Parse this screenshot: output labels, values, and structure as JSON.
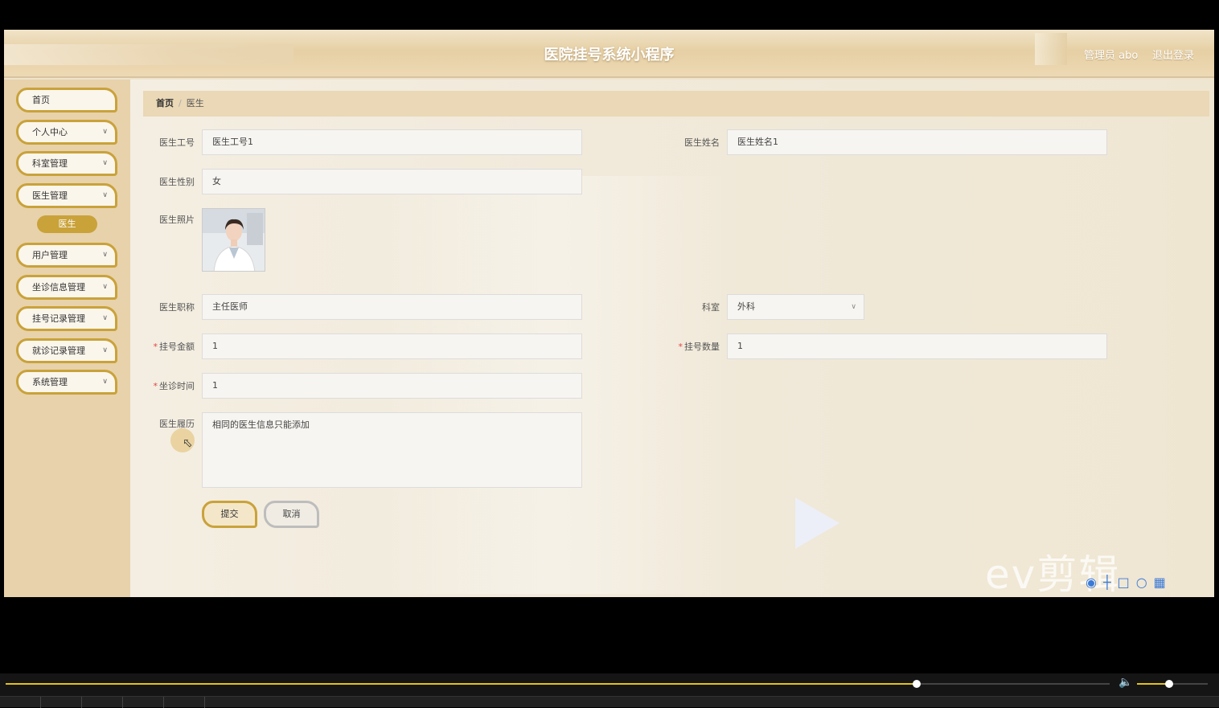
{
  "app": {
    "title": "医院挂号系统小程序",
    "user_label": "管理员 abo",
    "logout_label": "退出登录"
  },
  "sidebar": {
    "items": [
      {
        "label": "首页",
        "has_children": false
      },
      {
        "label": "个人中心",
        "has_children": true
      },
      {
        "label": "科室管理",
        "has_children": true
      },
      {
        "label": "医生管理",
        "has_children": true
      },
      {
        "label": "用户管理",
        "has_children": true
      },
      {
        "label": "坐诊信息管理",
        "has_children": true
      },
      {
        "label": "挂号记录管理",
        "has_children": true
      },
      {
        "label": "就诊记录管理",
        "has_children": true
      },
      {
        "label": "系统管理",
        "has_children": true
      }
    ],
    "active_sub": "医生"
  },
  "breadcrumb": {
    "home": "首页",
    "separator": "/",
    "current": "医生"
  },
  "form": {
    "doctor_id": {
      "label": "医生工号",
      "value": "医生工号1"
    },
    "doctor_name": {
      "label": "医生姓名",
      "value": "医生姓名1"
    },
    "doctor_gender": {
      "label": "医生性别",
      "value": "女"
    },
    "doctor_photo": {
      "label": "医生照片"
    },
    "doctor_title": {
      "label": "医生职称",
      "value": "主任医师"
    },
    "department": {
      "label": "科室",
      "value": "外科"
    },
    "fee": {
      "label": "挂号金额",
      "value": "1",
      "required": true
    },
    "quota": {
      "label": "挂号数量",
      "value": "1",
      "required": true
    },
    "clinic_time": {
      "label": "坐诊时间",
      "value": "1",
      "required": true
    },
    "resume": {
      "label": "医生履历",
      "value": "相同的医生信息只能添加"
    },
    "required_mark": "*",
    "submit_label": "提交",
    "cancel_label": "取消"
  },
  "player": {
    "progress": 0.825,
    "volume": 0.45
  },
  "watermark": {
    "text": "ev剪辑"
  },
  "colors": {
    "accent": "#c9a23a",
    "sidebar_bg": "#e8d2ab",
    "header_bg": "#e6cfa4",
    "required": "#e04444"
  }
}
